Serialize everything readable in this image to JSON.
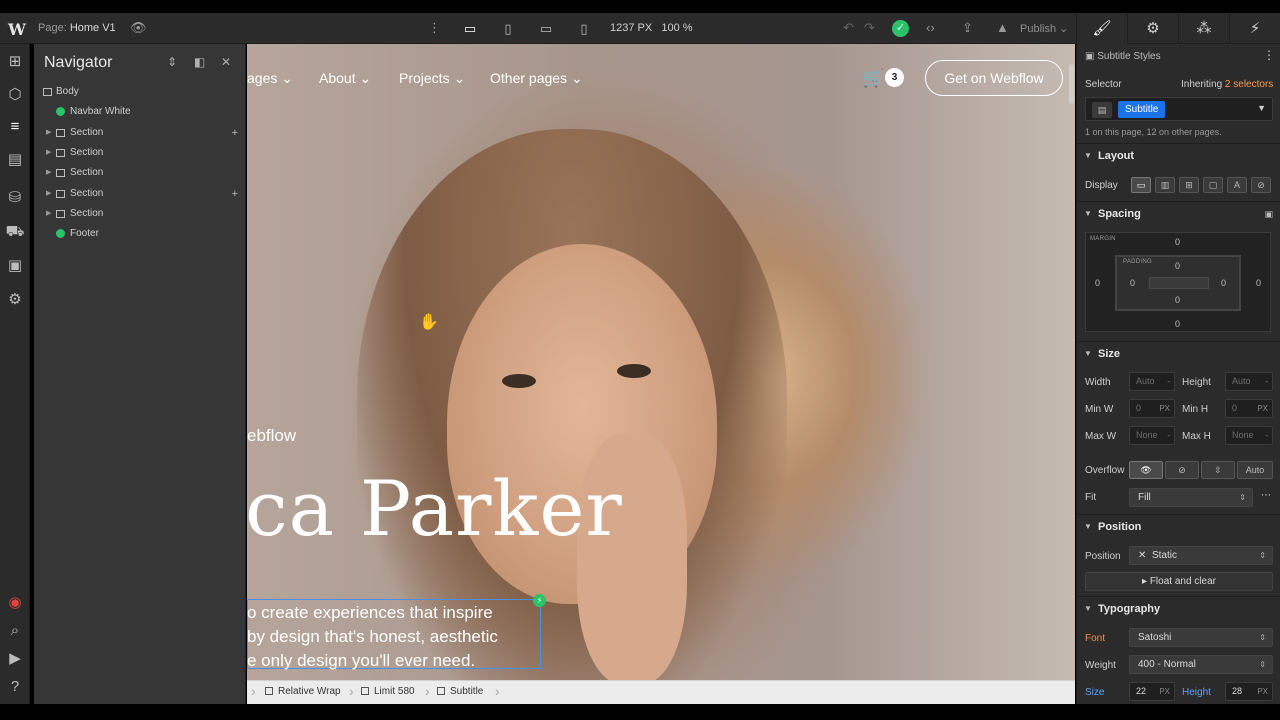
{
  "topbar": {
    "logo": "W",
    "page_label": "Page:",
    "page_name": "Home V1",
    "canvas_width": "1237 PX",
    "zoom": "100 %",
    "publish_label": "Publish",
    "status_check": "✓"
  },
  "navigator": {
    "title": "Navigator",
    "tree": [
      {
        "label": "Body",
        "type": "element",
        "indent": 0,
        "expandable": false
      },
      {
        "label": "Navbar White",
        "type": "component",
        "indent": 1,
        "expandable": false
      },
      {
        "label": "Section",
        "type": "element",
        "indent": 1,
        "expandable": true,
        "plus": true
      },
      {
        "label": "Section",
        "type": "element",
        "indent": 1,
        "expandable": true,
        "plus": false
      },
      {
        "label": "Section",
        "type": "element",
        "indent": 1,
        "expandable": true,
        "plus": false
      },
      {
        "label": "Section",
        "type": "element",
        "indent": 1,
        "expandable": true,
        "plus": true
      },
      {
        "label": "Section",
        "type": "element",
        "indent": 1,
        "expandable": true,
        "plus": false
      },
      {
        "label": "Footer",
        "type": "component",
        "indent": 1,
        "expandable": false
      }
    ]
  },
  "canvas": {
    "nav_links": [
      "ages",
      "About",
      "Projects",
      "Other pages"
    ],
    "cart_count": "3",
    "cta_label": "Get on Webflow",
    "kicker": "ebflow",
    "hero_name": "ca Parker",
    "subtitle_lines": [
      "o create experiences that inspire",
      "by design that's honest, aesthetic",
      "e only design you'll ever need."
    ]
  },
  "breadcrumbs": [
    "Relative Wrap",
    "Limit 580",
    "Subtitle"
  ],
  "panel": {
    "title": "Subtitle Styles",
    "selector_label": "Selector",
    "inheriting_prefix": "Inheriting",
    "inheriting_count": "2 selectors",
    "selector_tag": "Subtitle",
    "usage_note": "1 on this page, 12 on other pages.",
    "layout": {
      "heading": "Layout",
      "display_label": "Display"
    },
    "spacing": {
      "heading": "Spacing",
      "margin_label": "MARGIN",
      "padding_label": "PADDING",
      "margin": {
        "top": "0",
        "right": "0",
        "bottom": "0",
        "left": "0"
      },
      "padding": {
        "top": "0",
        "right": "0",
        "bottom": "0",
        "left": "0"
      }
    },
    "size": {
      "heading": "Size",
      "width_label": "Width",
      "width_value": "Auto",
      "height_label": "Height",
      "height_value": "Auto",
      "minw_label": "Min W",
      "minw_value": "0",
      "minw_unit": "PX",
      "minh_label": "Min H",
      "minh_value": "0",
      "minh_unit": "PX",
      "maxw_label": "Max W",
      "maxw_value": "None",
      "maxh_label": "Max H",
      "maxh_value": "None",
      "overflow_label": "Overflow",
      "overflow_auto": "Auto",
      "fit_label": "Fit",
      "fit_value": "Fill"
    },
    "position": {
      "heading": "Position",
      "position_label": "Position",
      "position_value": "Static",
      "float_label": "Float and clear"
    },
    "typography": {
      "heading": "Typography",
      "font_label": "Font",
      "font_value": "Satoshi",
      "weight_label": "Weight",
      "weight_value": "400 - Normal",
      "size_label": "Size",
      "size_value": "22",
      "size_unit": "PX",
      "lh_label": "Height",
      "lh_value": "28",
      "lh_unit": "PX"
    }
  },
  "colors": {
    "accent_blue": "#1a73e8",
    "accent_orange": "#ff8a3d",
    "success_green": "#2bc36a"
  }
}
